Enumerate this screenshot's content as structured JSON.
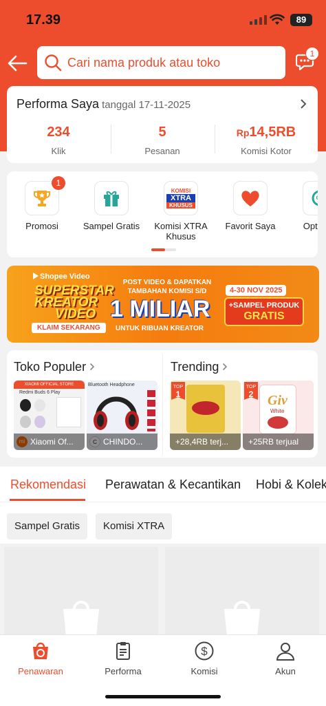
{
  "status_bar": {
    "time": "17.39",
    "battery": "89"
  },
  "search": {
    "placeholder": "Cari nama produk atau toko"
  },
  "chat": {
    "badge": "1"
  },
  "performance": {
    "title": "Performa Saya",
    "date_label": "tanggal 17-11-2025",
    "stats": [
      {
        "value": "234",
        "label": "Klik"
      },
      {
        "value": "5",
        "label": "Pesanan"
      },
      {
        "prefix": "Rp",
        "value": "14,5RB",
        "label": "Komisi Kotor"
      }
    ]
  },
  "menu": {
    "items": [
      {
        "label": "Promosi",
        "icon": "trophy-icon",
        "badge": "1"
      },
      {
        "label": "Sampel Gratis",
        "icon": "gift-icon"
      },
      {
        "label": "Komisi XTRA Khusus",
        "icon": "komisi-xtra-icon",
        "icon_text_1": "KOMISI",
        "icon_text_2": "XTRA",
        "icon_text_3": "KHUSUS"
      },
      {
        "label": "Favorit Saya",
        "icon": "heart-icon"
      },
      {
        "label": "Optimas",
        "icon": "optimize-icon"
      }
    ]
  },
  "banner": {
    "brand": "Shopee Video",
    "headline_1": "SUPERSTAR",
    "headline_2": "KREATOR",
    "headline_3": "VIDEO",
    "cta": "KLAIM SEKARANG",
    "post_line_1": "POST VIDEO & DAPATKAN",
    "post_line_2": "TAMBAHAN KOMISI S/D",
    "amount": "1 MILIAR",
    "sub": "UNTUK RIBUAN KREATOR",
    "date": "4-30 NOV 2025",
    "extra_1": "+SAMPEL PRODUK",
    "extra_2": "GRATIS"
  },
  "toko_populer": {
    "title": "Toko Populer",
    "stores": [
      {
        "name": "Xiaomi Of...",
        "logo": "mi",
        "img_title": "XIAOMI OFFICIAL STORE",
        "img_sub": "Redmi Buds 6 Play"
      },
      {
        "name": "CHINDO...",
        "logo": "C",
        "img_title": "Bluetooth Headphone"
      }
    ]
  },
  "trending": {
    "title": "Trending",
    "items": [
      {
        "rank_label": "TOP",
        "rank": "1",
        "caption": "+28,4RB terj..."
      },
      {
        "rank_label": "TOP",
        "rank": "2",
        "caption": "+25RB terjual",
        "brand": "Giv",
        "brand_sub": "White"
      }
    ]
  },
  "tabs": [
    "Rekomendasi",
    "Perawatan & Kecantikan",
    "Hobi & Kolek"
  ],
  "chips": [
    "Sampel Gratis",
    "Komisi XTRA"
  ],
  "bottom_nav": [
    {
      "label": "Penawaran",
      "icon": "offer-bag-icon"
    },
    {
      "label": "Performa",
      "icon": "clipboard-icon"
    },
    {
      "label": "Komisi",
      "icon": "dollar-icon"
    },
    {
      "label": "Akun",
      "icon": "person-icon"
    }
  ],
  "colors": {
    "brand": "#ee4d2d",
    "background": "#f2f2f2"
  }
}
